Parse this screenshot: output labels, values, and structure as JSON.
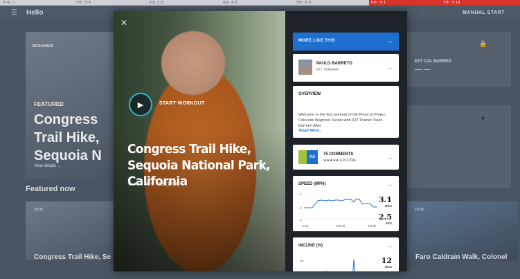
{
  "status_strip": {
    "items": [
      "9:41:1",
      "5th 3:6",
      "3rd 3:5",
      "4th 4:0",
      "5th 0:0",
      "6th 9:1",
      "7th 3:14"
    ]
  },
  "background": {
    "header_title": "Hello",
    "manual_start": "MANUAL START",
    "card_badge": "BEGINNER",
    "featured_tag": "FEATURED",
    "card_title": "Congress Trail Hike, Sequoia N",
    "view_details": "View details  →",
    "featured_now": "Featured now",
    "row_card_left_title": "Congress Trail Hike, Se",
    "row_card_left_time": "26:00",
    "row_card_right_title": "Faro Caldrain Walk, Colonel",
    "row_card_right_time": "18:00",
    "est_cal_label": "EST CAL BURNED",
    "est_cal_value": "— —"
  },
  "modal": {
    "start_workout": "START WORKOUT",
    "title": "Congress Trail Hike, Sequoia National Park, California",
    "rating_stars": "★★★★★",
    "rating_text": "4.9 (1704)",
    "more_like_this": "MORE LIKE THIS",
    "trainer_name": "PAULO BARRETO",
    "trainer_role": "iFIT TRAINER",
    "overview_heading": "OVERVIEW",
    "overview_text": "Welcome to the first workout of the Pines to Peaks: Colorado Beginner Series with iFIT Trainer Paulo Barreto! After",
    "read_more": "Read More...",
    "comments_count": "75 COMMENTS",
    "comments_stars": "★★★★★",
    "comments_rating": "4.9 (1704)",
    "comments_badge": "AA",
    "speed_heading": "SPEED (MPH)",
    "speed_max": "3.1",
    "speed_max_label": "MAX",
    "speed_avg": "2.5",
    "speed_avg_label": "AVG",
    "speed_y_ticks": [
      "4",
      "2",
      "0"
    ],
    "speed_x_ticks": [
      "0 mi",
      "0.5 mi",
      "1.0 mi"
    ],
    "incline_heading": "INCLINE (%)",
    "incline_max": "12",
    "incline_max_label": "MAX",
    "incline_y_tick": "15"
  },
  "colors": {
    "accent_blue": "#1f6fd1",
    "play_ring": "#29b8c9",
    "status_red": "#d8342c",
    "chart_line": "#1f6fd1"
  },
  "icons": {
    "menu": "hamburger-icon",
    "close": "close-icon",
    "play": "play-icon",
    "arrow": "arrow-right-icon",
    "lock": "lock-icon",
    "info": "info-icon"
  }
}
